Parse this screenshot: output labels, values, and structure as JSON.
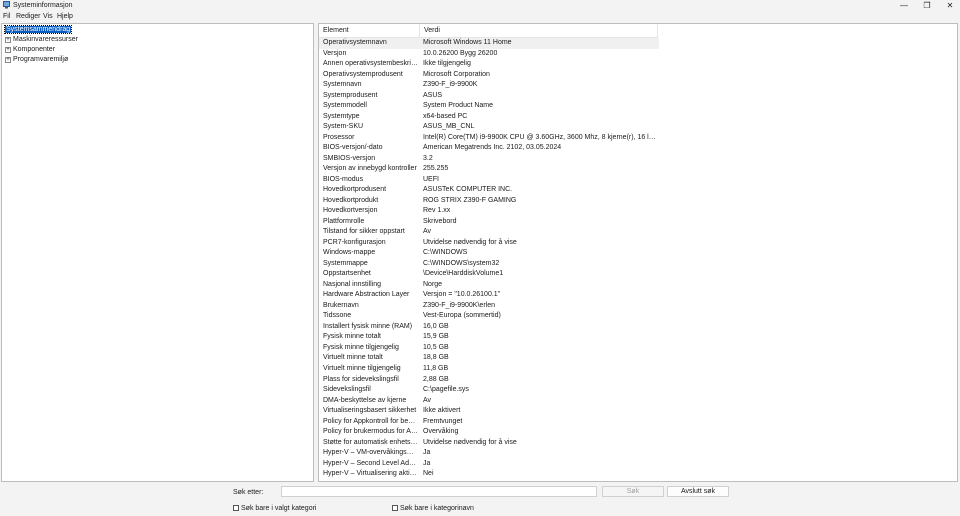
{
  "window": {
    "title": "Systeminformasjon",
    "controls": {
      "minimize": "—",
      "maximize": "❐",
      "close": "✕"
    }
  },
  "menu": [
    "Fil",
    "Rediger",
    "Vis",
    "Hjelp"
  ],
  "tree": [
    {
      "label": "Systemsammendrag",
      "selected": true
    },
    {
      "label": "Maskinvareressurser",
      "expander": "+"
    },
    {
      "label": "Komponenter",
      "expander": "+"
    },
    {
      "label": "Programvaremiljø",
      "expander": "+"
    }
  ],
  "table": {
    "columns": [
      "Element",
      "Verdi"
    ],
    "rows": [
      [
        "Operativsystemnavn",
        "Microsoft Windows 11 Home"
      ],
      [
        "Versjon",
        "10.0.26200 Bygg 26200"
      ],
      [
        "Annen operativsystembeskrivel...",
        "Ikke tilgjengelig"
      ],
      [
        "Operativsystemprodusent",
        "Microsoft Corporation"
      ],
      [
        "Systemnavn",
        "Z390-F_i9-9900K"
      ],
      [
        "Systemprodusent",
        "ASUS"
      ],
      [
        "Systemmodell",
        "System Product Name"
      ],
      [
        "Systemtype",
        "x64-based PC"
      ],
      [
        "System-SKU",
        "ASUS_MB_CNL"
      ],
      [
        "Prosessor",
        "Intel(R) Core(TM) i9-9900K CPU @ 3.60GHz, 3600 Mhz, 8 kjerne(r), 16 logiske ..."
      ],
      [
        "BIOS-versjon/-dato",
        "American Megatrends Inc. 2102, 03.05.2024"
      ],
      [
        "SMBIOS-versjon",
        "3.2"
      ],
      [
        "Versjon av innebygd kontroller",
        "255.255"
      ],
      [
        "BIOS-modus",
        "UEFI"
      ],
      [
        "Hovedkortprodusent",
        "ASUSTeK COMPUTER INC."
      ],
      [
        "Hovedkortprodukt",
        "ROG STRIX Z390-F GAMING"
      ],
      [
        "Hovedkortversjon",
        "Rev 1.xx"
      ],
      [
        "Plattformrolle",
        "Skrivebord"
      ],
      [
        "Tilstand for sikker oppstart",
        "Av"
      ],
      [
        "PCR7-konfigurasjon",
        "Utvidelse nødvendig for å vise"
      ],
      [
        "Windows-mappe",
        "C:\\WINDOWS"
      ],
      [
        "Systemmappe",
        "C:\\WINDOWS\\system32"
      ],
      [
        "Oppstartsenhet",
        "\\Device\\HarddiskVolume1"
      ],
      [
        "Nasjonal innstilling",
        "Norge"
      ],
      [
        "Hardware Abstraction Layer",
        "Versjon = \"10.0.26100.1\""
      ],
      [
        "Brukernavn",
        "Z390-F_i9-9900K\\erlen"
      ],
      [
        "Tidssone",
        "Vest-Europa (sommertid)"
      ],
      [
        "Installert fysisk minne (RAM)",
        "16,0 GB"
      ],
      [
        "Fysisk minne totalt",
        "15,9 GB"
      ],
      [
        "Fysisk minne tilgjengelig",
        "10,5 GB"
      ],
      [
        "Virtuelt minne totalt",
        "18,8 GB"
      ],
      [
        "Virtuelt minne tilgjengelig",
        "11,8 GB"
      ],
      [
        "Plass for sidevekslingsfil",
        "2,88 GB"
      ],
      [
        "Sidevekslingsfil",
        "C:\\pagefile.sys"
      ],
      [
        "DMA-beskyttelse av kjerne",
        "Av"
      ],
      [
        "Virtualiseringsbasert sikkerhet",
        "Ikke aktivert"
      ],
      [
        "Policy for Appkontroll for bedri...",
        "Fremtvunget"
      ],
      [
        "Policy for brukermodus for Ap...",
        "Overvåking"
      ],
      [
        "Støtte for automatisk enhetskry...",
        "Utvidelse nødvendig for å vise"
      ],
      [
        "Hyper-V – VM-overvåkingsmo...",
        "Ja"
      ],
      [
        "Hyper-V – Second Level Addre...",
        "Ja"
      ],
      [
        "Hyper-V – Virtualisering aktiver...",
        "Nei"
      ]
    ]
  },
  "search": {
    "label": "Søk etter:",
    "value": "",
    "search_button": "Søk",
    "close_button": "Avslutt søk",
    "check_selected": "Søk bare i valgt kategori",
    "check_names": "Søk bare i kategorinavn"
  },
  "colors": {
    "selection": "#0a5dc2",
    "background": "#f3f3f3"
  }
}
